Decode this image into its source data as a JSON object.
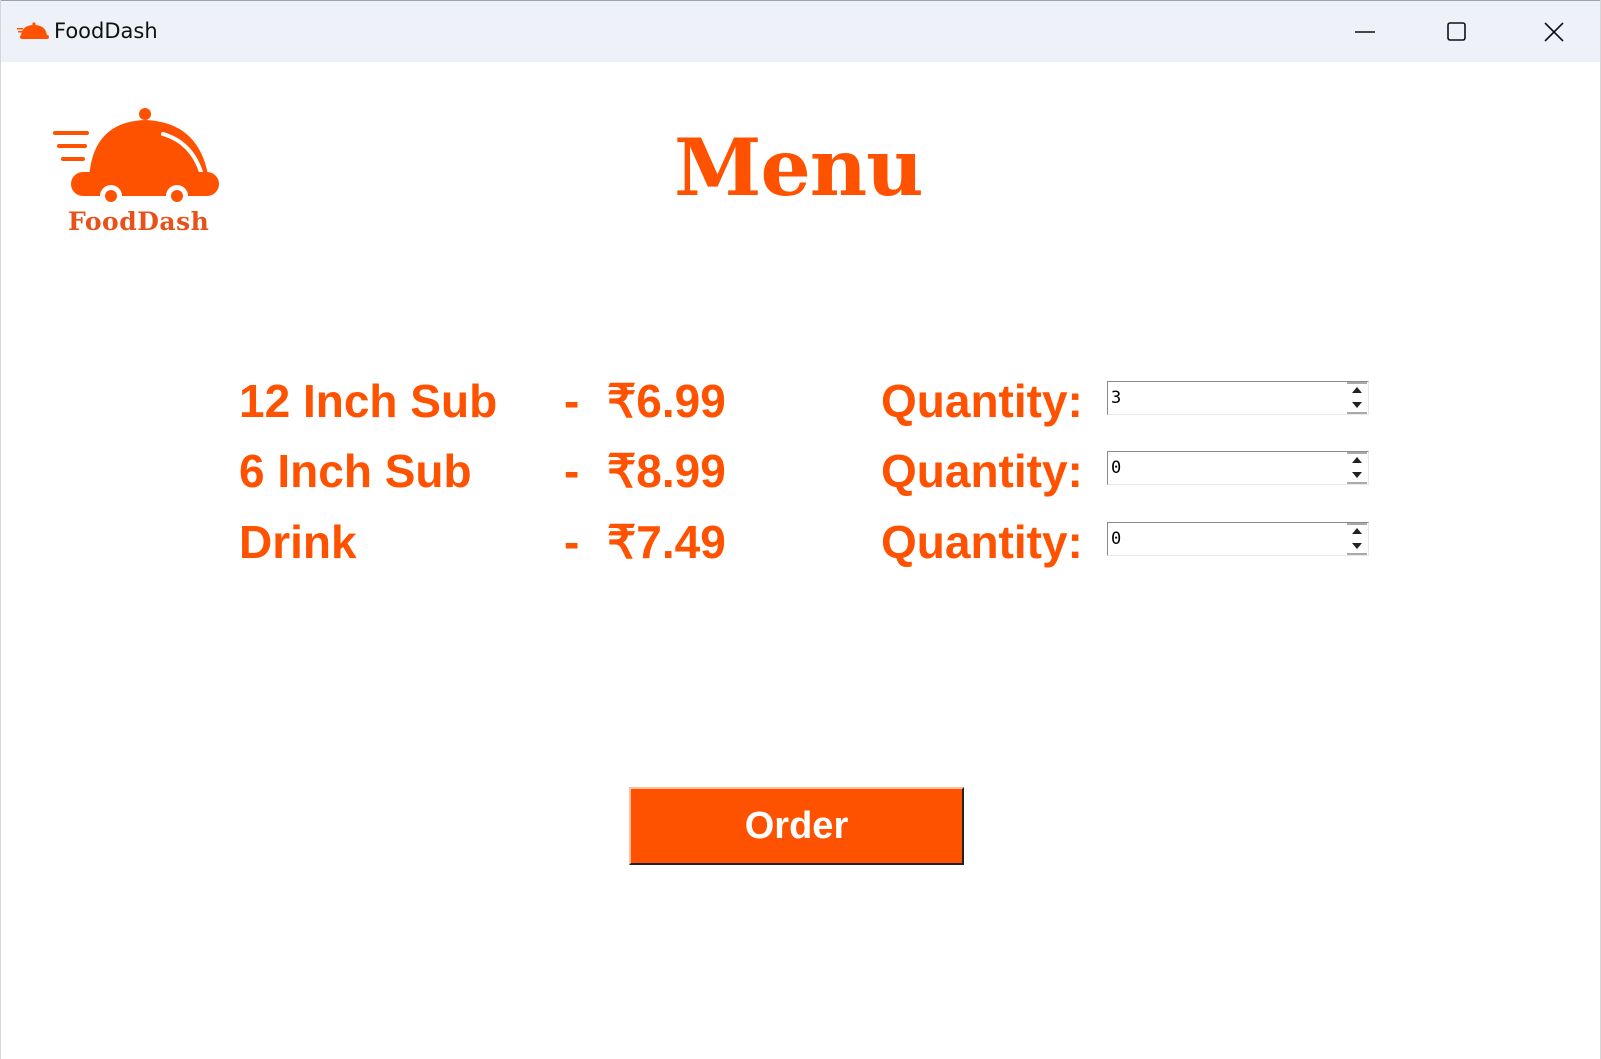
{
  "window": {
    "title": "FoodDash"
  },
  "logo": {
    "text": "FoodDash",
    "icon": "food-delivery-cloche-icon"
  },
  "page": {
    "title": "Menu"
  },
  "items": [
    {
      "name": "12 Inch Sub",
      "separator": "-",
      "price": "₹6.99",
      "quantity_label": "Quantity:",
      "quantity": "3"
    },
    {
      "name": "6 Inch Sub",
      "separator": "-",
      "price": "₹8.99",
      "quantity_label": "Quantity:",
      "quantity": "0"
    },
    {
      "name": "Drink",
      "separator": "-",
      "price": "₹7.49",
      "quantity_label": "Quantity:",
      "quantity": "0"
    }
  ],
  "actions": {
    "order_label": "Order"
  },
  "colors": {
    "accent": "#ff5200",
    "titlebar": "#eef2f8",
    "background": "#ffffff"
  }
}
